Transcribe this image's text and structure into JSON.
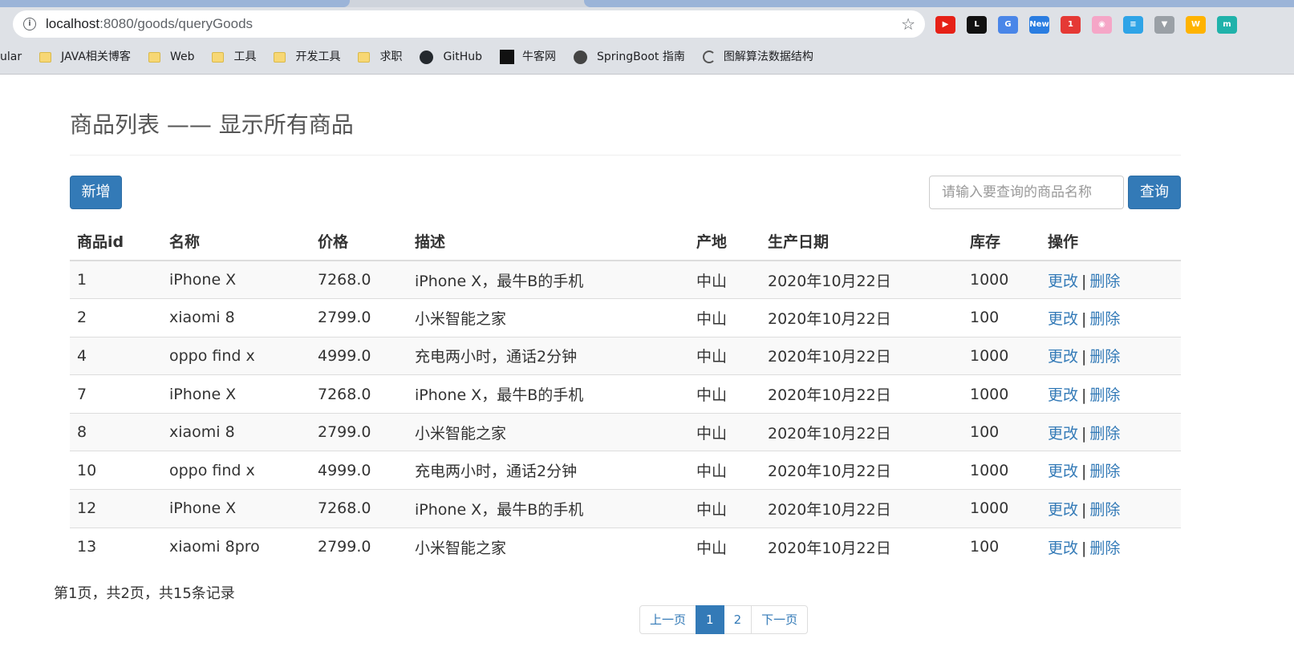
{
  "browser": {
    "url_host": "localhost",
    "url_path": ":8080/goods/queryGoods",
    "extensions": [
      {
        "name": "youtube-extension-icon",
        "color": "#e62117",
        "text": "▶"
      },
      {
        "name": "leetcode-extension-icon",
        "color": "#111111",
        "text": "L"
      },
      {
        "name": "translate-extension-icon",
        "color": "#4a86e8",
        "text": "G"
      },
      {
        "name": "news-extension-icon",
        "color": "#2a7de1",
        "text": "New"
      },
      {
        "name": "badge-extension-icon",
        "color": "#e53935",
        "text": "1"
      },
      {
        "name": "bilibili-extension-icon",
        "color": "#f5a6c7",
        "text": "◉"
      },
      {
        "name": "notes-extension-icon",
        "color": "#2fa4e7",
        "text": "≡"
      },
      {
        "name": "vue-extension-icon",
        "color": "#9aa0a6",
        "text": "▼"
      },
      {
        "name": "w-extension-icon",
        "color": "#ffb300",
        "text": "W"
      },
      {
        "name": "m-extension-icon",
        "color": "#20b2aa",
        "text": "m"
      }
    ],
    "bookmarks": [
      {
        "label": "ular",
        "icon": "none"
      },
      {
        "label": "JAVA相关博客",
        "icon": "folder"
      },
      {
        "label": "Web",
        "icon": "folder"
      },
      {
        "label": "工具",
        "icon": "folder"
      },
      {
        "label": "开发工具",
        "icon": "folder"
      },
      {
        "label": "求职",
        "icon": "folder"
      },
      {
        "label": "GitHub",
        "icon": "github"
      },
      {
        "label": "牛客网",
        "icon": "nowcoder"
      },
      {
        "label": "SpringBoot 指南",
        "icon": "globe"
      },
      {
        "label": "图解算法数据结构",
        "icon": "hook"
      }
    ]
  },
  "page": {
    "title": "商品列表 —— 显示所有商品",
    "add_label": "新增",
    "search_placeholder": "请输入要查询的商品名称",
    "search_label": "查询"
  },
  "table": {
    "headers": {
      "id": "商品id",
      "name": "名称",
      "price": "价格",
      "desc": "描述",
      "origin": "产地",
      "date": "生产日期",
      "stock": "库存",
      "ops": "操作"
    },
    "edit_label": "更改",
    "separator": "|",
    "delete_label": "删除",
    "rows": [
      {
        "id": "1",
        "name": "iPhone X",
        "price": "7268.0",
        "desc": "iPhone X，最牛B的手机",
        "origin": "中山",
        "date": "2020年10月22日",
        "stock": "1000"
      },
      {
        "id": "2",
        "name": "xiaomi 8",
        "price": "2799.0",
        "desc": "小米智能之家",
        "origin": "中山",
        "date": "2020年10月22日",
        "stock": "100"
      },
      {
        "id": "4",
        "name": "oppo find x",
        "price": "4999.0",
        "desc": "充电两小时，通话2分钟",
        "origin": "中山",
        "date": "2020年10月22日",
        "stock": "1000"
      },
      {
        "id": "7",
        "name": "iPhone X",
        "price": "7268.0",
        "desc": "iPhone X，最牛B的手机",
        "origin": "中山",
        "date": "2020年10月22日",
        "stock": "1000"
      },
      {
        "id": "8",
        "name": "xiaomi 8",
        "price": "2799.0",
        "desc": "小米智能之家",
        "origin": "中山",
        "date": "2020年10月22日",
        "stock": "100"
      },
      {
        "id": "10",
        "name": "oppo find x",
        "price": "4999.0",
        "desc": "充电两小时，通话2分钟",
        "origin": "中山",
        "date": "2020年10月22日",
        "stock": "1000"
      },
      {
        "id": "12",
        "name": "iPhone X",
        "price": "7268.0",
        "desc": "iPhone X，最牛B的手机",
        "origin": "中山",
        "date": "2020年10月22日",
        "stock": "1000"
      },
      {
        "id": "13",
        "name": "xiaomi 8pro",
        "price": "2799.0",
        "desc": "小米智能之家",
        "origin": "中山",
        "date": "2020年10月22日",
        "stock": "100"
      }
    ]
  },
  "pagination": {
    "info": "第1页，共2页，共15条记录",
    "prev_label": "上一页",
    "pages": [
      "1",
      "2"
    ],
    "current_page": "1",
    "next_label": "下一页"
  },
  "colors": {
    "primary": "#337ab7",
    "stripe": "#f9f9f9",
    "border": "#dddddd"
  }
}
